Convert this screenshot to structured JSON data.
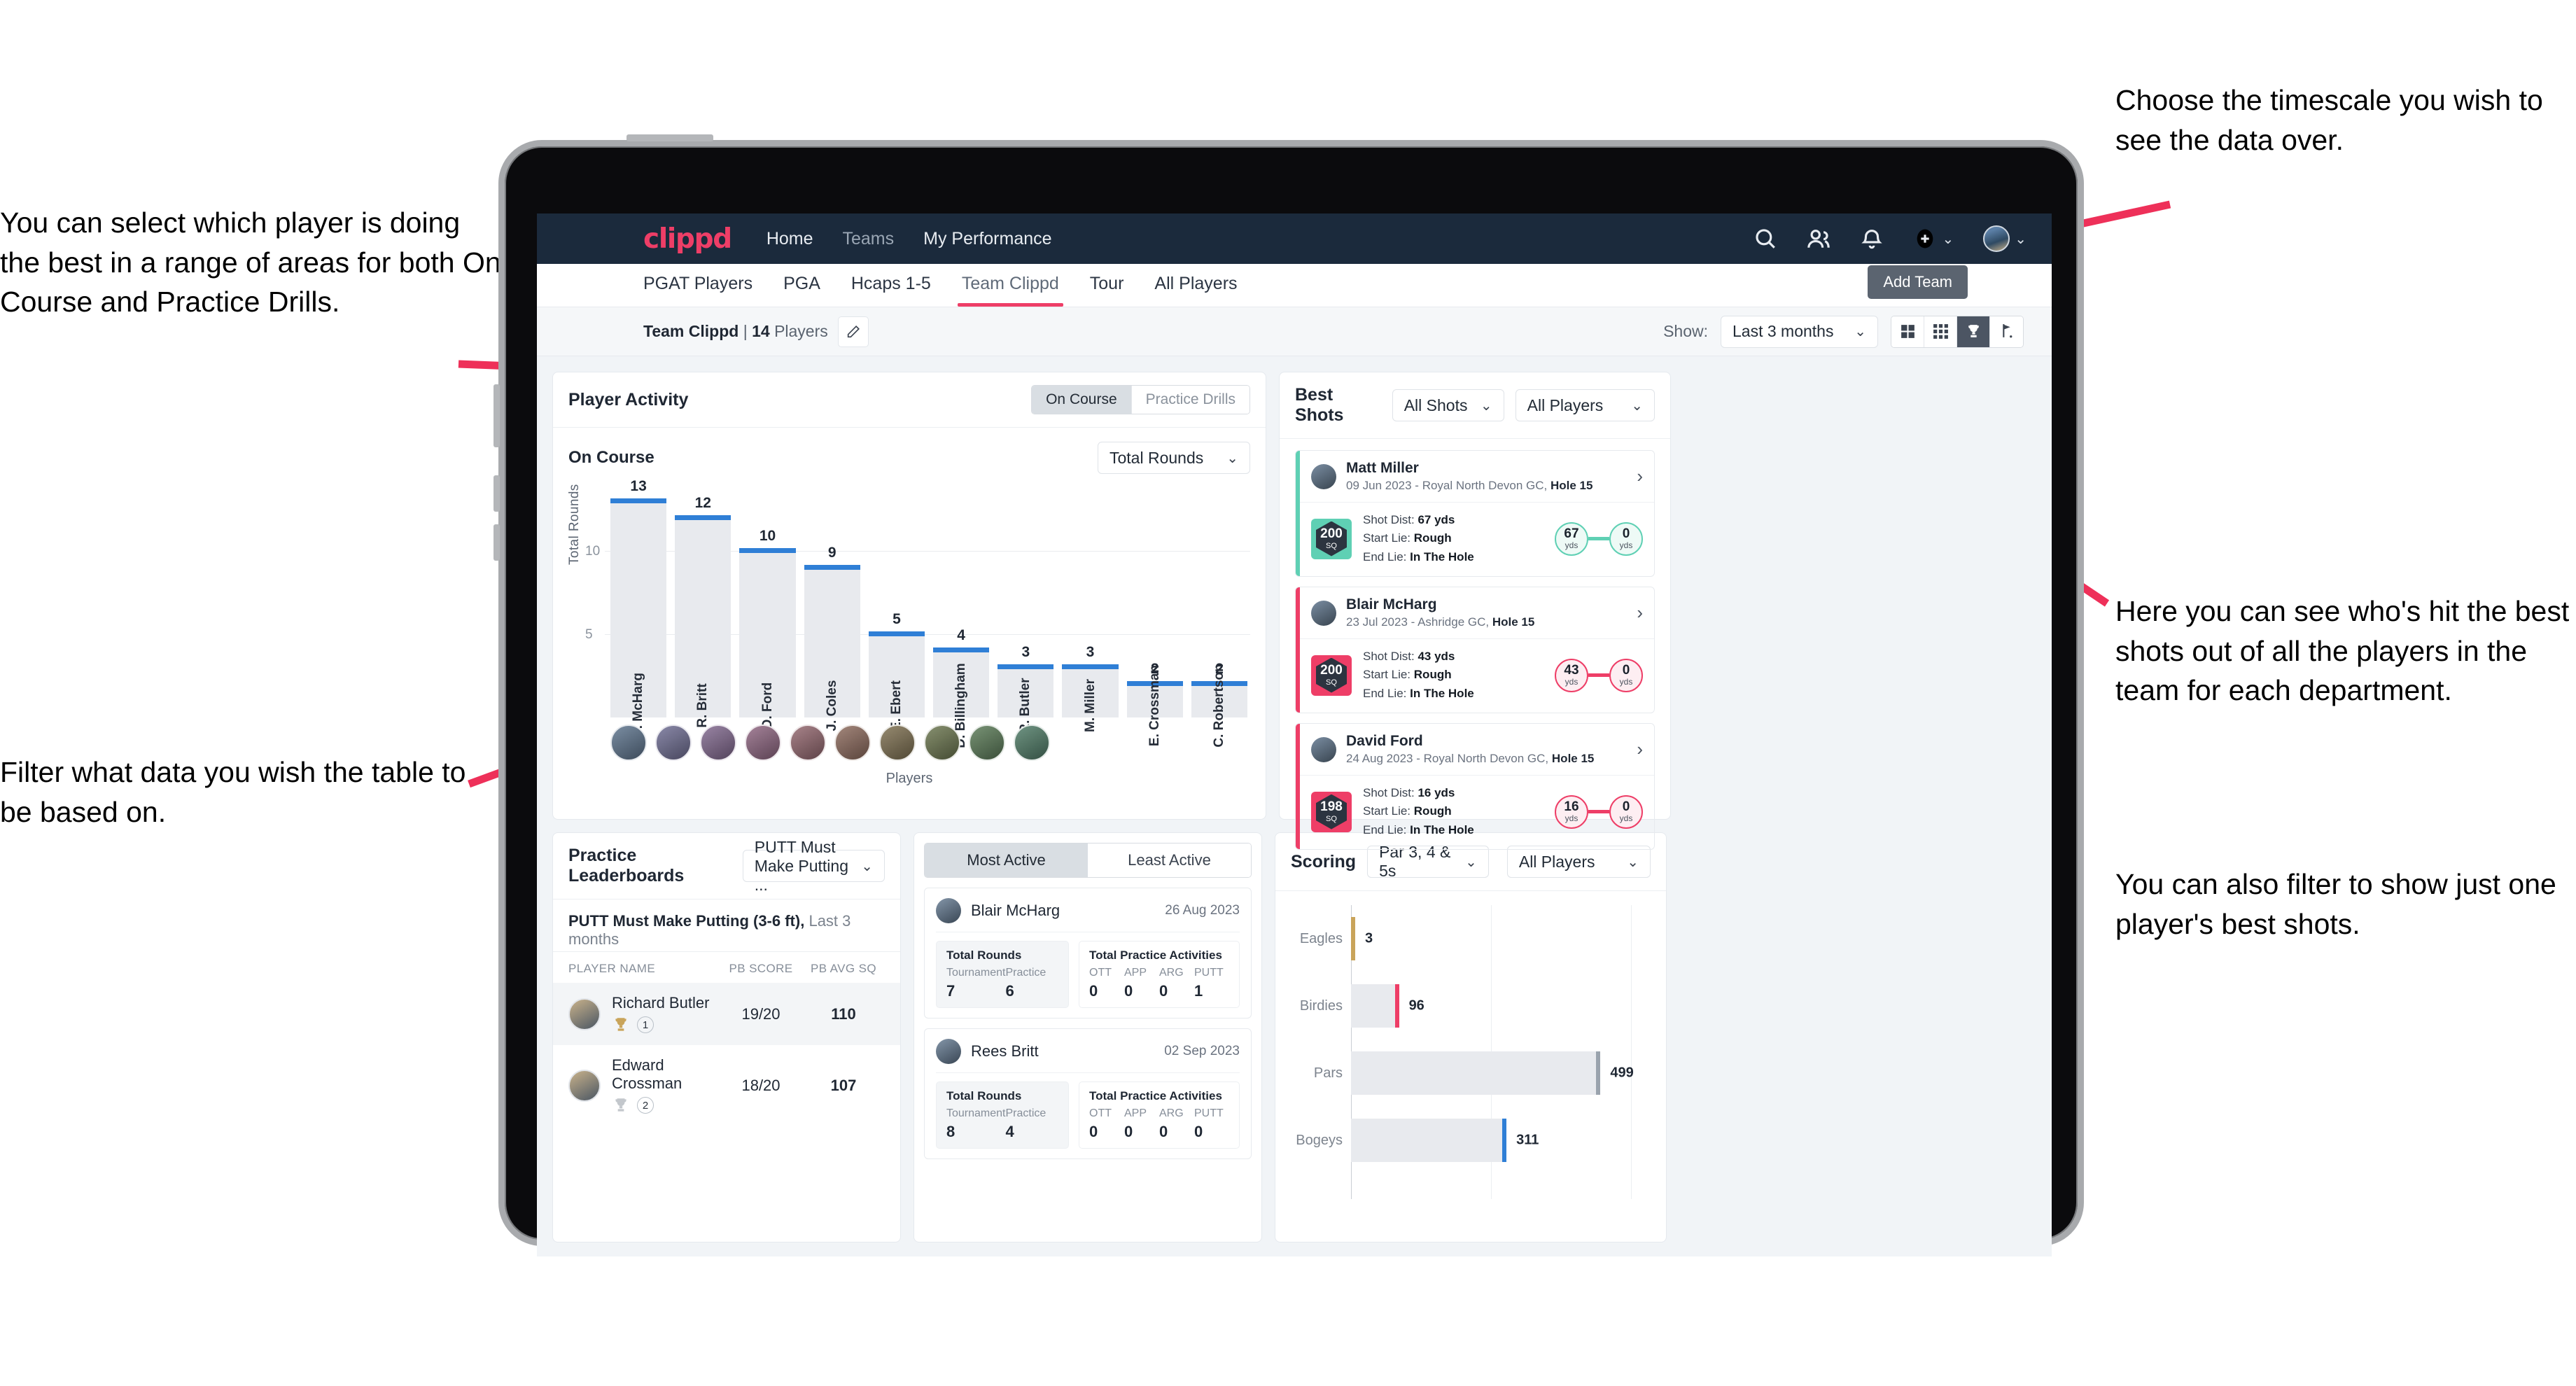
{
  "annotations": {
    "left_top": "You can select which player is doing the best in a range of areas for both On Course and Practice Drills.",
    "left_bottom": "Filter what data you wish the table to be based on.",
    "right_top": "Choose the timescale you wish to see the data over.",
    "right_middle": "Here you can see who's hit the best shots out of all the players in the team for each department.",
    "right_bottom": "You can also filter to show just one player's best shots."
  },
  "app": {
    "logo": "clippd",
    "nav": [
      {
        "label": "Home",
        "active": true
      },
      {
        "label": "Teams",
        "active": false
      },
      {
        "label": "My Performance",
        "active": true
      }
    ],
    "nav_icons": [
      "search-icon",
      "people-icon",
      "bell-icon",
      "plus-circle-icon",
      "avatar-icon"
    ],
    "tabs": [
      {
        "label": "PGAT Players",
        "active": false
      },
      {
        "label": "PGA",
        "active": false
      },
      {
        "label": "Hcaps 1-5",
        "active": false
      },
      {
        "label": "Team Clippd",
        "active": true
      },
      {
        "label": "Tour",
        "active": false
      },
      {
        "label": "All Players",
        "active": false
      }
    ],
    "tooltip": "Add Team",
    "team_name": "Team Clippd",
    "team_count": "14",
    "team_count_suffix": "Players",
    "edit_icon": "pencil-icon",
    "show_label": "Show:",
    "timescale": "Last 3 months",
    "view_toggles": [
      {
        "icon": "grid-2x2-icon",
        "active": false
      },
      {
        "icon": "grid-3x3-icon",
        "active": false
      },
      {
        "icon": "trophy-icon",
        "active": true
      },
      {
        "icon": "flag-icon",
        "active": false
      }
    ]
  },
  "player_activity": {
    "title": "Player Activity",
    "segments": [
      {
        "label": "On Course",
        "active": true
      },
      {
        "label": "Practice Drills",
        "active": false
      }
    ],
    "subtitle": "On Course",
    "metric_select": "Total Rounds"
  },
  "best_shots": {
    "title": "Best Shots",
    "shot_filter": "All Shots",
    "player_filter": "All Players",
    "accent_teal": "#5fd0b4",
    "accent_pink": "#ee3e67",
    "items": [
      {
        "name": "Matt Miller",
        "meta_date": "09 Jun 2023 - Royal North Devon GC,",
        "meta_hole": "Hole 15",
        "score": "200",
        "score_unit": "SQ",
        "shot_dist_label": "Shot Dist:",
        "shot_dist": "67 yds",
        "start_lie_label": "Start Lie:",
        "start_lie": "Rough",
        "end_lie_label": "End Lie:",
        "end_lie": "In The Hole",
        "from_value": "67",
        "from_unit": "yds",
        "to_value": "0",
        "to_unit": "yds",
        "color": "#5fd0b4"
      },
      {
        "name": "Blair McHarg",
        "meta_date": "23 Jul 2023 - Ashridge GC,",
        "meta_hole": "Hole 15",
        "score": "200",
        "score_unit": "SQ",
        "shot_dist_label": "Shot Dist:",
        "shot_dist": "43 yds",
        "start_lie_label": "Start Lie:",
        "start_lie": "Rough",
        "end_lie_label": "End Lie:",
        "end_lie": "In The Hole",
        "from_value": "43",
        "from_unit": "yds",
        "to_value": "0",
        "to_unit": "yds",
        "color": "#ee3e67"
      },
      {
        "name": "David Ford",
        "meta_date": "24 Aug 2023 - Royal North Devon GC,",
        "meta_hole": "Hole 15",
        "score": "198",
        "score_unit": "SQ",
        "shot_dist_label": "Shot Dist:",
        "shot_dist": "16 yds",
        "start_lie_label": "Start Lie:",
        "start_lie": "Rough",
        "end_lie_label": "End Lie:",
        "end_lie": "In The Hole",
        "from_value": "16",
        "from_unit": "yds",
        "to_value": "0",
        "to_unit": "yds",
        "color": "#ee3e67"
      }
    ]
  },
  "practice_leaderboards": {
    "title": "Practice Leaderboards",
    "drill_select": "PUTT Must Make Putting ...",
    "subtitle_bold": "PUTT Must Make Putting (3-6 ft),",
    "subtitle_light": "Last 3 months",
    "columns": [
      "PLAYER NAME",
      "PB SCORE",
      "PB AVG SQ"
    ],
    "rows": [
      {
        "name": "Richard Butler",
        "rank": "1",
        "trophy": "gold",
        "pb_score": "19/20",
        "pb_avg_sq": "110",
        "highlight": true
      },
      {
        "name": "Edward Crossman",
        "rank": "2",
        "trophy": "silver",
        "pb_score": "18/20",
        "pb_avg_sq": "107",
        "highlight": false
      }
    ]
  },
  "activity_feed": {
    "tabs": [
      {
        "label": "Most Active",
        "active": true
      },
      {
        "label": "Least Active",
        "active": false
      }
    ],
    "rounds_title": "Total Rounds",
    "practice_title": "Total Practice Activities",
    "rounds_cols": [
      "Tournament",
      "Practice"
    ],
    "practice_cols": [
      "OTT",
      "APP",
      "ARG",
      "PUTT"
    ],
    "items": [
      {
        "name": "Blair McHarg",
        "date": "26 Aug 2023",
        "rounds": [
          "7",
          "6"
        ],
        "practice": [
          "0",
          "0",
          "0",
          "1"
        ]
      },
      {
        "name": "Rees Britt",
        "date": "02 Sep 2023",
        "rounds": [
          "8",
          "4"
        ],
        "practice": [
          "0",
          "0",
          "0",
          "0"
        ]
      }
    ]
  },
  "scoring": {
    "title": "Scoring",
    "par_select": "Par 3, 4 & 5s",
    "player_select": "All Players"
  },
  "chart_data": [
    {
      "type": "bar",
      "title": "Player Activity — On Course",
      "xlabel": "Players",
      "ylabel": "Total Rounds",
      "ylim": [
        0,
        13
      ],
      "yticks": [
        5,
        10
      ],
      "grid": true,
      "categories": [
        "B. McHarg",
        "R. Britt",
        "D. Ford",
        "J. Coles",
        "E. Ebert",
        "D. Billingham",
        "R. Butler",
        "M. Miller",
        "E. Crossman",
        "C. Robertson"
      ],
      "values": [
        13,
        12,
        10,
        9,
        5,
        4,
        3,
        3,
        2,
        2
      ],
      "bar_color": "#e8eaee",
      "cap_color": "#2f7fd6"
    },
    {
      "type": "bar",
      "orientation": "horizontal",
      "title": "Scoring",
      "categories": [
        "Eagles",
        "Birdies",
        "Pars",
        "Bogeys"
      ],
      "values": [
        3,
        96,
        499,
        311
      ],
      "xlim": [
        0,
        560
      ],
      "colors": [
        "#c9a45a",
        "#ee3e67",
        "#9aa3ad",
        "#2f7fd6"
      ],
      "grid": true
    }
  ]
}
